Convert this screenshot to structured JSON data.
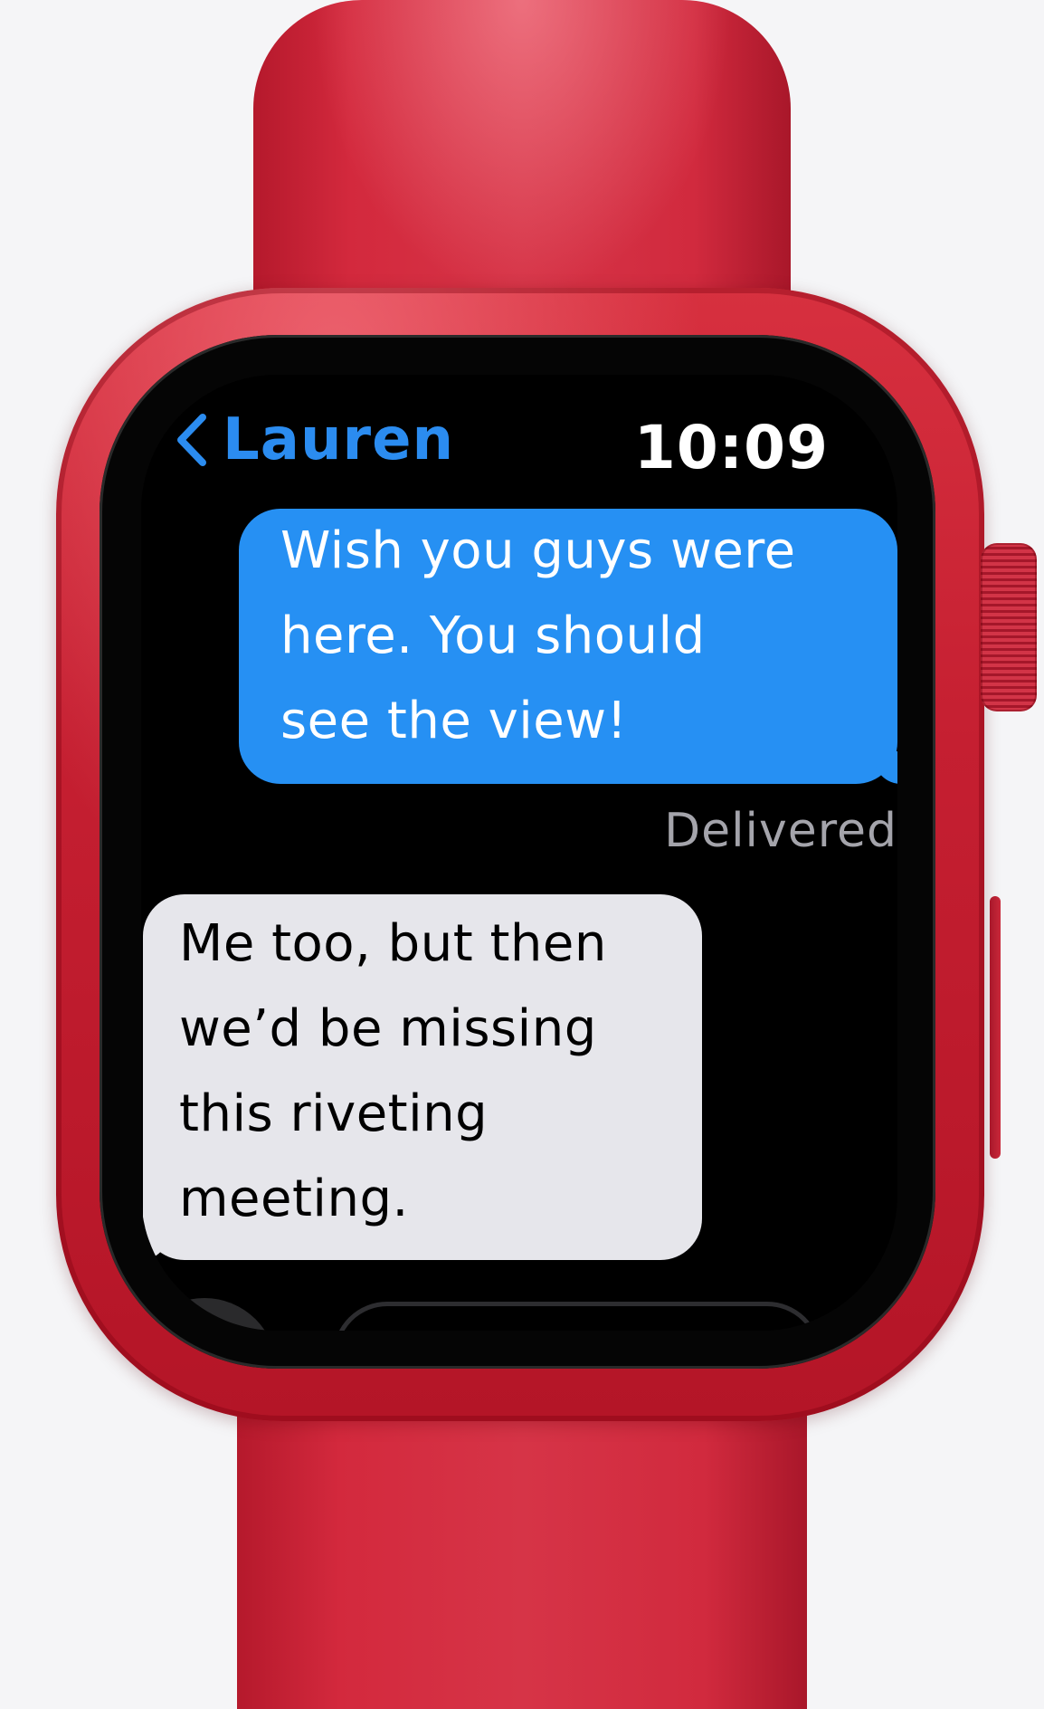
{
  "device": {
    "band_color": "#d12a3e",
    "case_color": "#c51f31",
    "screen_color": "#000000"
  },
  "header": {
    "back_icon": "chevron-left-icon",
    "contact_name": "Lauren",
    "time": "10:09",
    "accent_color": "#2b8cf0"
  },
  "messages": [
    {
      "direction": "outgoing",
      "text": "Wish you guys were\nhere. You should\nsee the view!",
      "bubble_color": "#2690f3"
    },
    {
      "direction": "incoming",
      "text": "Me too, but then\nwe’d be missing\nthis riveting\nmeeting.",
      "bubble_color": "#e6e6eb"
    }
  ],
  "status": {
    "delivered": "Delivered"
  }
}
